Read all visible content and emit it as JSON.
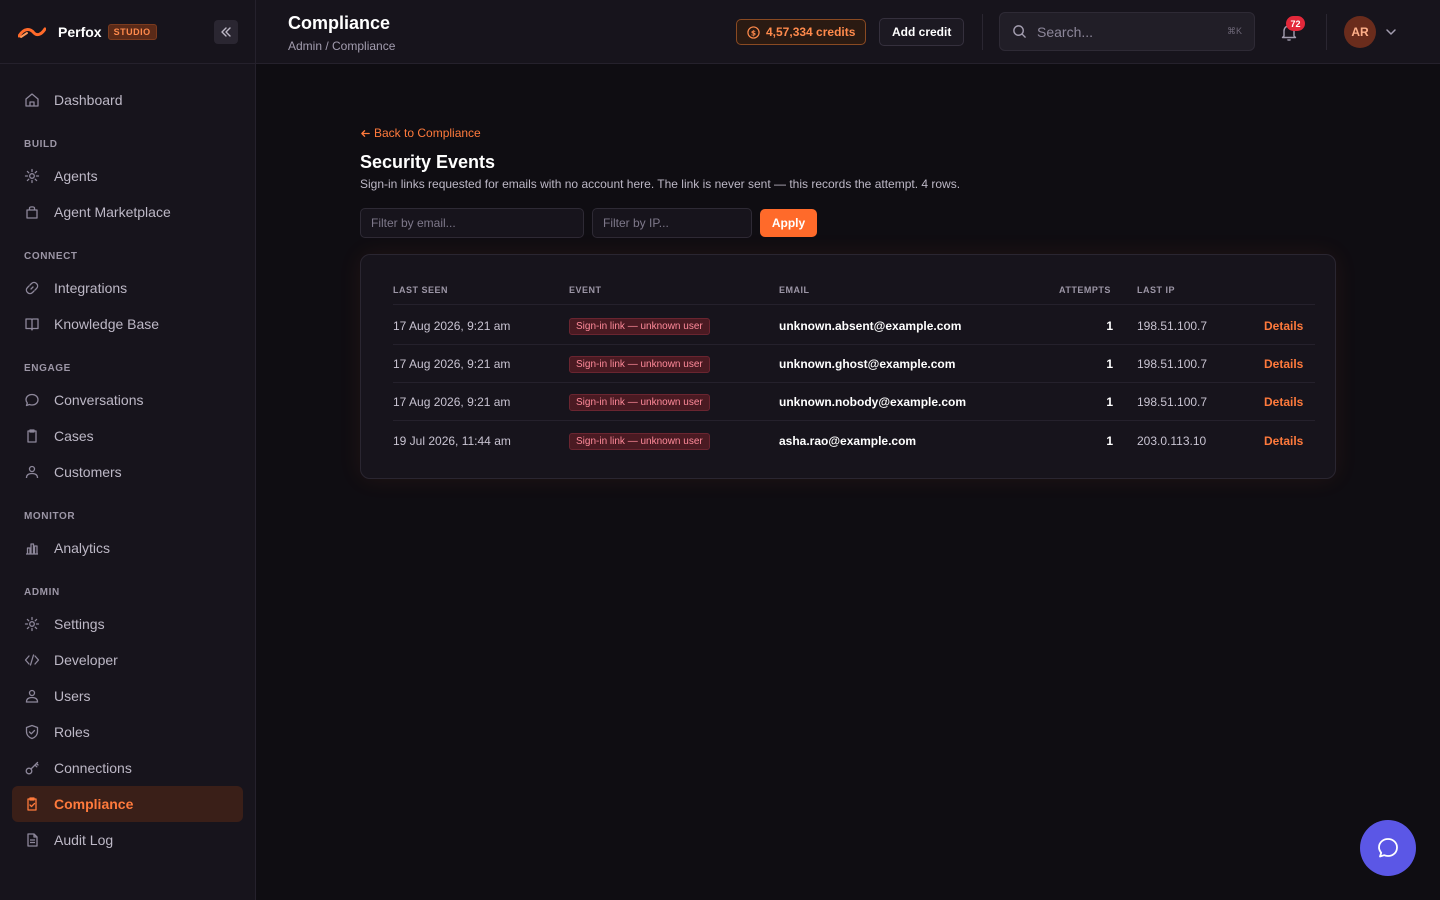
{
  "brand": {
    "name": "Perfox",
    "badge": "STUDIO"
  },
  "sidebar": {
    "top": [
      {
        "label": "Dashboard",
        "icon": "home-icon"
      }
    ],
    "sections": [
      {
        "title": "BUILD",
        "items": [
          {
            "label": "Agents",
            "icon": "gear-icon"
          },
          {
            "label": "Agent Marketplace",
            "icon": "bag-icon"
          }
        ]
      },
      {
        "title": "CONNECT",
        "items": [
          {
            "label": "Integrations",
            "icon": "link-icon"
          },
          {
            "label": "Knowledge Base",
            "icon": "book-icon"
          }
        ]
      },
      {
        "title": "ENGAGE",
        "items": [
          {
            "label": "Conversations",
            "icon": "chat-icon"
          },
          {
            "label": "Cases",
            "icon": "clipboard-icon"
          },
          {
            "label": "Customers",
            "icon": "users-icon"
          }
        ]
      },
      {
        "title": "MONITOR",
        "items": [
          {
            "label": "Analytics",
            "icon": "chart-icon"
          }
        ]
      },
      {
        "title": "ADMIN",
        "items": [
          {
            "label": "Settings",
            "icon": "gear-icon"
          },
          {
            "label": "Developer",
            "icon": "code-icon"
          },
          {
            "label": "Users",
            "icon": "user-icon"
          },
          {
            "label": "Roles",
            "icon": "shield-icon"
          },
          {
            "label": "Connections",
            "icon": "key-icon"
          },
          {
            "label": "Compliance",
            "icon": "clipboard-check-icon",
            "active": true
          },
          {
            "label": "Audit Log",
            "icon": "document-icon"
          }
        ]
      }
    ]
  },
  "header": {
    "title": "Compliance",
    "breadcrumb": "Admin / Compliance",
    "credits": "4,57,334 credits",
    "add_credit": "Add credit",
    "search_placeholder": "Search...",
    "search_shortcut": "⌘K",
    "notifications": "72",
    "avatar": "AR"
  },
  "main": {
    "back_link": "Back to Compliance",
    "title": "Security Events",
    "description": "Sign-in links requested for emails with no account here. The link is never sent — this records the attempt. 4 rows.",
    "filter_email_placeholder": "Filter by email...",
    "filter_ip_placeholder": "Filter by IP...",
    "apply": "Apply",
    "columns": {
      "last_seen": "LAST SEEN",
      "event": "EVENT",
      "email": "EMAIL",
      "attempts": "ATTEMPTS",
      "last_ip": "LAST IP"
    },
    "rows": [
      {
        "last_seen": "17 Aug 2026, 9:21 am",
        "event": "Sign-in link — unknown user",
        "email": "unknown.absent@example.com",
        "attempts": "1",
        "last_ip": "198.51.100.7",
        "action": "Details"
      },
      {
        "last_seen": "17 Aug 2026, 9:21 am",
        "event": "Sign-in link — unknown user",
        "email": "unknown.ghost@example.com",
        "attempts": "1",
        "last_ip": "198.51.100.7",
        "action": "Details"
      },
      {
        "last_seen": "17 Aug 2026, 9:21 am",
        "event": "Sign-in link — unknown user",
        "email": "unknown.nobody@example.com",
        "attempts": "1",
        "last_ip": "198.51.100.7",
        "action": "Details"
      },
      {
        "last_seen": "19 Jul 2026, 11:44 am",
        "event": "Sign-in link — unknown user",
        "email": "asha.rao@example.com",
        "attempts": "1",
        "last_ip": "203.0.113.10",
        "action": "Details"
      }
    ]
  },
  "colors": {
    "accent": "#ff6a2a",
    "background": "#0f0d12",
    "sidebar": "#17141c",
    "chat_fab": "#5b57e6"
  }
}
